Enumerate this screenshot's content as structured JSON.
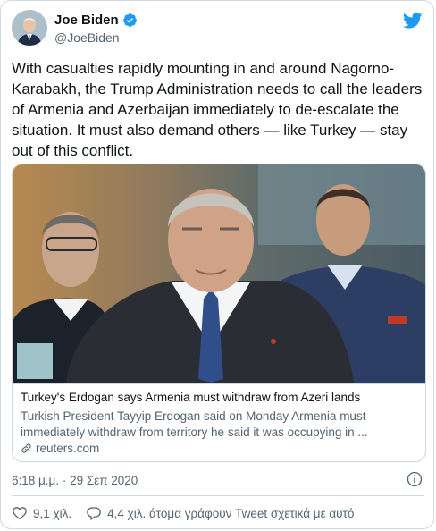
{
  "author": {
    "name": "Joe Biden",
    "handle": "@JoeBiden",
    "verified_icon": "verified-badge-icon",
    "avatar": "profile-photo"
  },
  "brand_icon": "twitter-bird-icon",
  "tweet": {
    "text": "With casualties rapidly mounting in and around Nagorno-Karabakh, the Trump Administration needs to call the leaders of Armenia and Azerbaijan immediately to de-escalate the situation. It must also demand others — like Turkey — stay out of this conflict.",
    "timestamp": "6:18 μ.μ. · 29 Σεπ 2020"
  },
  "link_card": {
    "title": "Turkey's Erdogan says Armenia must withdraw from Azeri lands",
    "description": "Turkish President Tayyip Erdogan said on Monday Armenia must immediately withdraw from territory he said it was occupying in ...",
    "domain": "reuters.com"
  },
  "actions": {
    "likes": "9,1 χιλ.",
    "talking": "4,4 χιλ. άτομα γράφουν Tweet σχετικά με αυτό"
  },
  "colors": {
    "twitter_blue": "#1d9bf0",
    "secondary_text": "#536471",
    "border": "#cfd9de"
  }
}
